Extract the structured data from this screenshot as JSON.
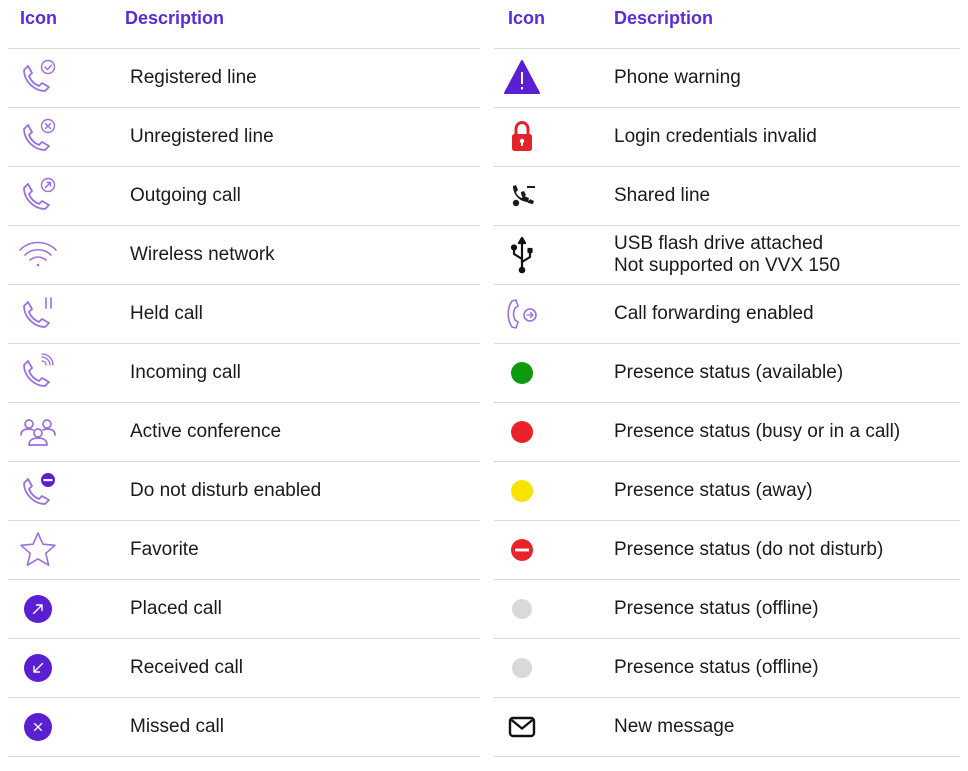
{
  "headers": {
    "icon": "Icon",
    "description": "Description"
  },
  "colors": {
    "header": "#5b2bd6",
    "lavender_icon": "#9a6fe0",
    "purple_dark": "#5a1fd1",
    "divider": "#d7d7d7"
  },
  "left_rows": [
    {
      "icon": "phone-check-icon",
      "label": "Registered line"
    },
    {
      "icon": "phone-x-icon",
      "label": "Unregistered line"
    },
    {
      "icon": "phone-outgoing-icon",
      "label": "Outgoing call"
    },
    {
      "icon": "wifi-icon",
      "label": "Wireless network"
    },
    {
      "icon": "phone-hold-icon",
      "label": "Held call"
    },
    {
      "icon": "phone-incoming-icon",
      "label": "Incoming call"
    },
    {
      "icon": "conference-icon",
      "label": "Active conference"
    },
    {
      "icon": "phone-dnd-icon",
      "label": "Do not disturb enabled"
    },
    {
      "icon": "star-icon",
      "label": "Favorite"
    },
    {
      "icon": "placed-call-icon",
      "label": "Placed call"
    },
    {
      "icon": "received-call-icon",
      "label": "Received call"
    },
    {
      "icon": "missed-call-icon",
      "label": "Missed call"
    }
  ],
  "right_rows": [
    {
      "icon": "warning-icon",
      "label": "Phone warning"
    },
    {
      "icon": "lock-icon",
      "label": "Login credentials invalid"
    },
    {
      "icon": "shared-line-icon",
      "label": "Shared line"
    },
    {
      "icon": "usb-icon",
      "label": "USB flash drive attached",
      "label2": "Not supported on VVX 150"
    },
    {
      "icon": "call-forward-icon",
      "label": "Call forwarding enabled"
    },
    {
      "icon": "presence-available-icon",
      "label": "Presence status (available)"
    },
    {
      "icon": "presence-busy-icon",
      "label": "Presence status (busy or in a call)"
    },
    {
      "icon": "presence-away-icon",
      "label": "Presence status (away)"
    },
    {
      "icon": "presence-dnd-icon",
      "label": "Presence status (do not disturb)"
    },
    {
      "icon": "presence-offline-icon",
      "label": "Presence status (offline)"
    },
    {
      "icon": "presence-offline-icon",
      "label": "Presence status (offline)"
    },
    {
      "icon": "envelope-icon",
      "label": "New message"
    }
  ]
}
